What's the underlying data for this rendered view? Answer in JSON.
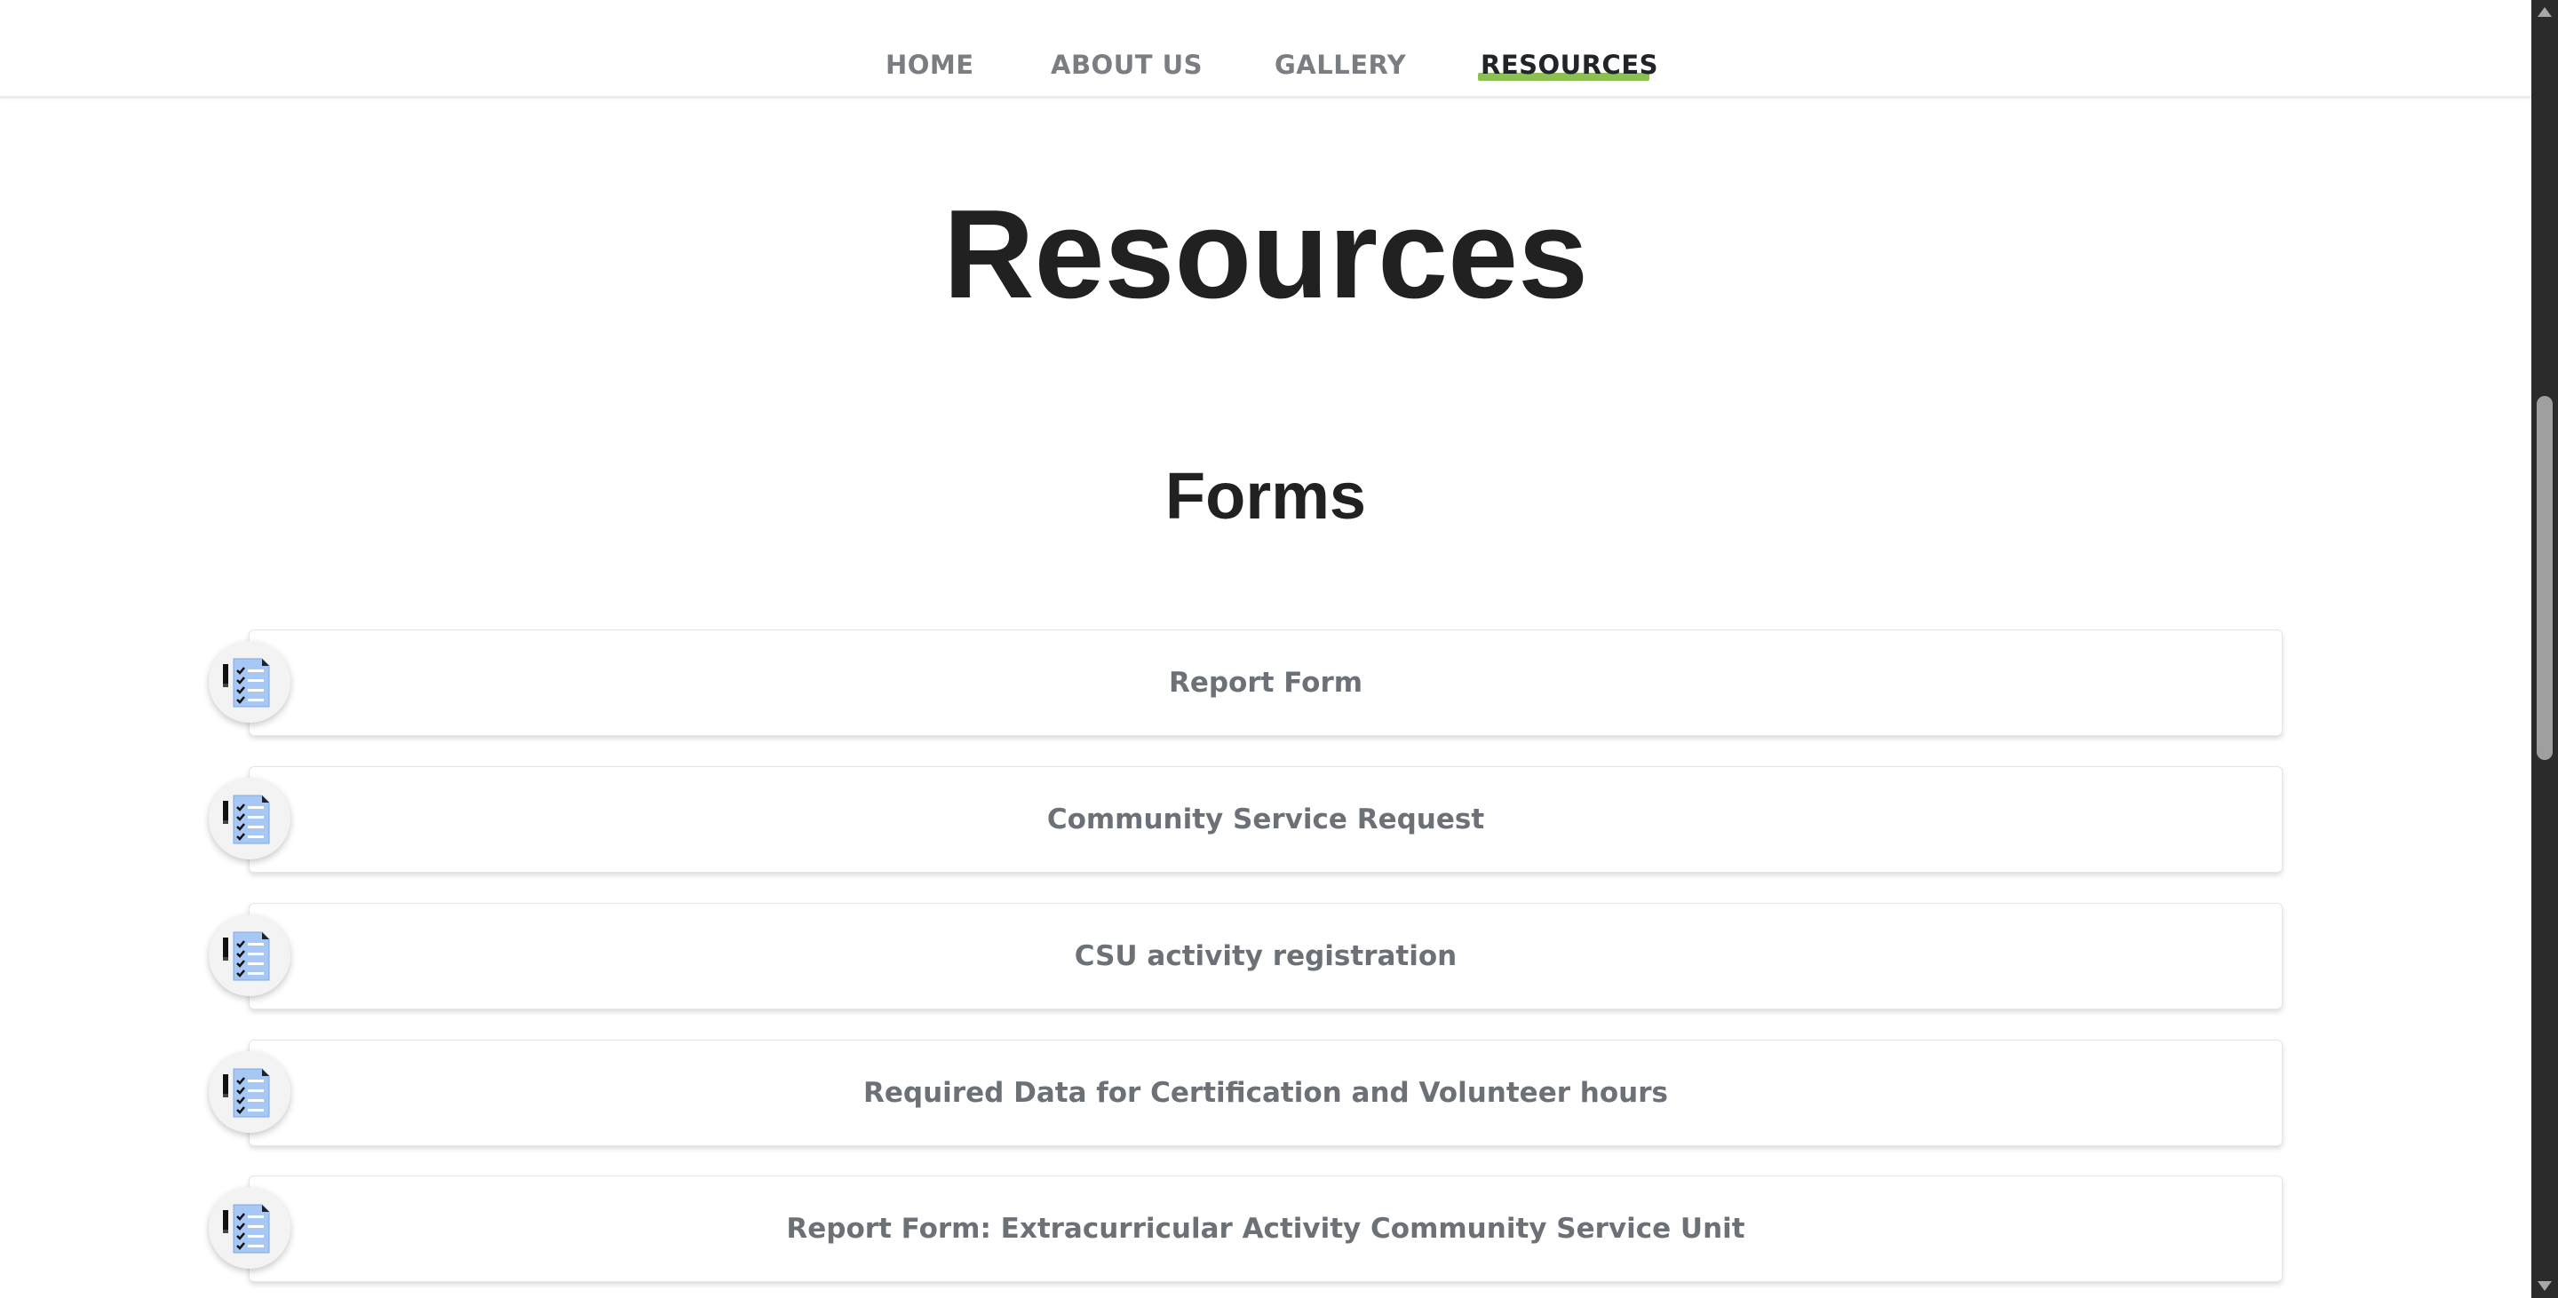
{
  "nav": {
    "items": [
      {
        "label": "HOME",
        "active": false
      },
      {
        "label": "ABOUT US",
        "active": false
      },
      {
        "label": "GALLERY",
        "active": false
      },
      {
        "label": "RESOURCES",
        "active": true
      }
    ],
    "active_underline_color": "#8cc152"
  },
  "page": {
    "title": "Resources"
  },
  "forms_section": {
    "title": "Forms",
    "items": [
      {
        "label": "Report Form",
        "icon": "checklist-document-icon"
      },
      {
        "label": "Community Service Request",
        "icon": "checklist-document-icon"
      },
      {
        "label": "CSU activity registration",
        "icon": "checklist-document-icon"
      },
      {
        "label": "Required Data for Certification and Volunteer hours",
        "icon": "checklist-document-icon"
      },
      {
        "label": "Report Form: Extracurricular Activity Community Service Unit",
        "icon": "checklist-document-icon"
      }
    ]
  },
  "colors": {
    "text_dark": "#212121",
    "text_muted": "#6c7177",
    "icon_paper": "#a7c8f5",
    "scrollbar_track": "#2b2b2b"
  }
}
